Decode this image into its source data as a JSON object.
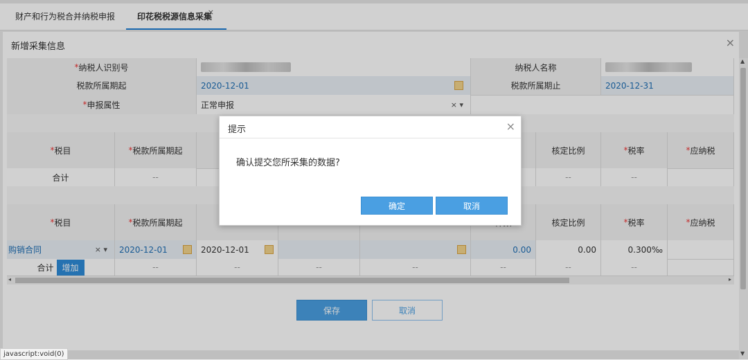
{
  "tabs": [
    {
      "label": "财产和行为税合并纳税申报"
    },
    {
      "label": "印花税税源信息采集",
      "close": "×"
    }
  ],
  "panel": {
    "title": "新增采集信息",
    "close": "×"
  },
  "form": {
    "taxpayer_id_label": "纳税人识别号",
    "taxpayer_name_label": "纳税人名称",
    "period_start_label": "税款所属期起",
    "period_start_value": "2020-12-01",
    "period_end_label": "税款所属期止",
    "period_end_value": "2020-12-31",
    "declare_attr_label": "申报属性",
    "declare_attr_value": "正常申报",
    "clear_dropdown": "× ▾",
    "required_mark": "*"
  },
  "table1": {
    "headers": [
      "税目",
      "税款所属期起",
      "",
      "",
      "",
      "件数",
      "核定比例",
      "税率",
      "应纳税"
    ],
    "total_row": [
      "合计",
      "--",
      "",
      "",
      "",
      "",
      "--",
      "--",
      ""
    ]
  },
  "table2": {
    "headers": [
      "税目",
      "税款所属期起",
      "",
      "",
      "",
      "件数",
      "核定比例",
      "税率",
      "应纳税"
    ],
    "row": {
      "item": "购销合同",
      "clear": "× ▾",
      "start": "2020-12-01",
      "end": "2020-12-01",
      "amount": "0.00",
      "ratio": "0.00",
      "rate": "0.300‰"
    },
    "total": {
      "label": "合计",
      "add_button": "增加",
      "dashes": "--"
    }
  },
  "actions": {
    "save": "保存",
    "cancel": "取消"
  },
  "dialog": {
    "title": "提示",
    "close": "×",
    "message": "确认提交您所采集的数据?",
    "ok": "确定",
    "cancel": "取消"
  },
  "statusbar": "javascript:void(0)",
  "colors": {
    "accent": "#4a9fe2",
    "required": "#e33333",
    "selected_tab": "#1f80d7"
  }
}
